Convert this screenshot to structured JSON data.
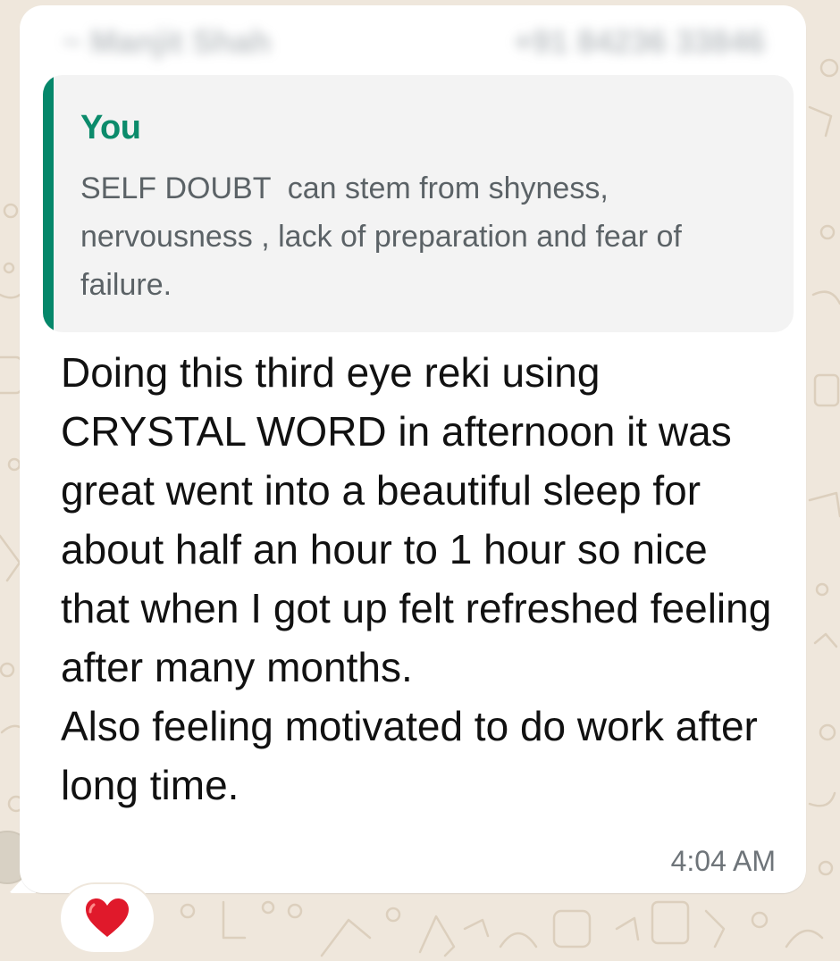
{
  "chat": {
    "sender_name": "~ Manjit Shah",
    "sender_phone": "+91 84236 33846"
  },
  "quoted_message": {
    "author": "You",
    "text": "SELF DOUBT  can stem from shyness, nervousness , lack of preparation and fear of failure."
  },
  "message": {
    "text": "Doing this third eye reki using CRYSTAL WORD in afternoon it was great went into a beautiful sleep for about half an hour to 1 hour so nice that when I got up felt refreshed feeling after many months.\nAlso feeling motivated to do work after long time.",
    "time": "4:04 AM"
  },
  "reaction": {
    "emoji": "❤️",
    "icon": "heart-icon",
    "color": "#e0192b"
  },
  "colors": {
    "background": "#efe7dc",
    "quote_accent": "#05876a",
    "quote_author": "#0b8b6b"
  }
}
